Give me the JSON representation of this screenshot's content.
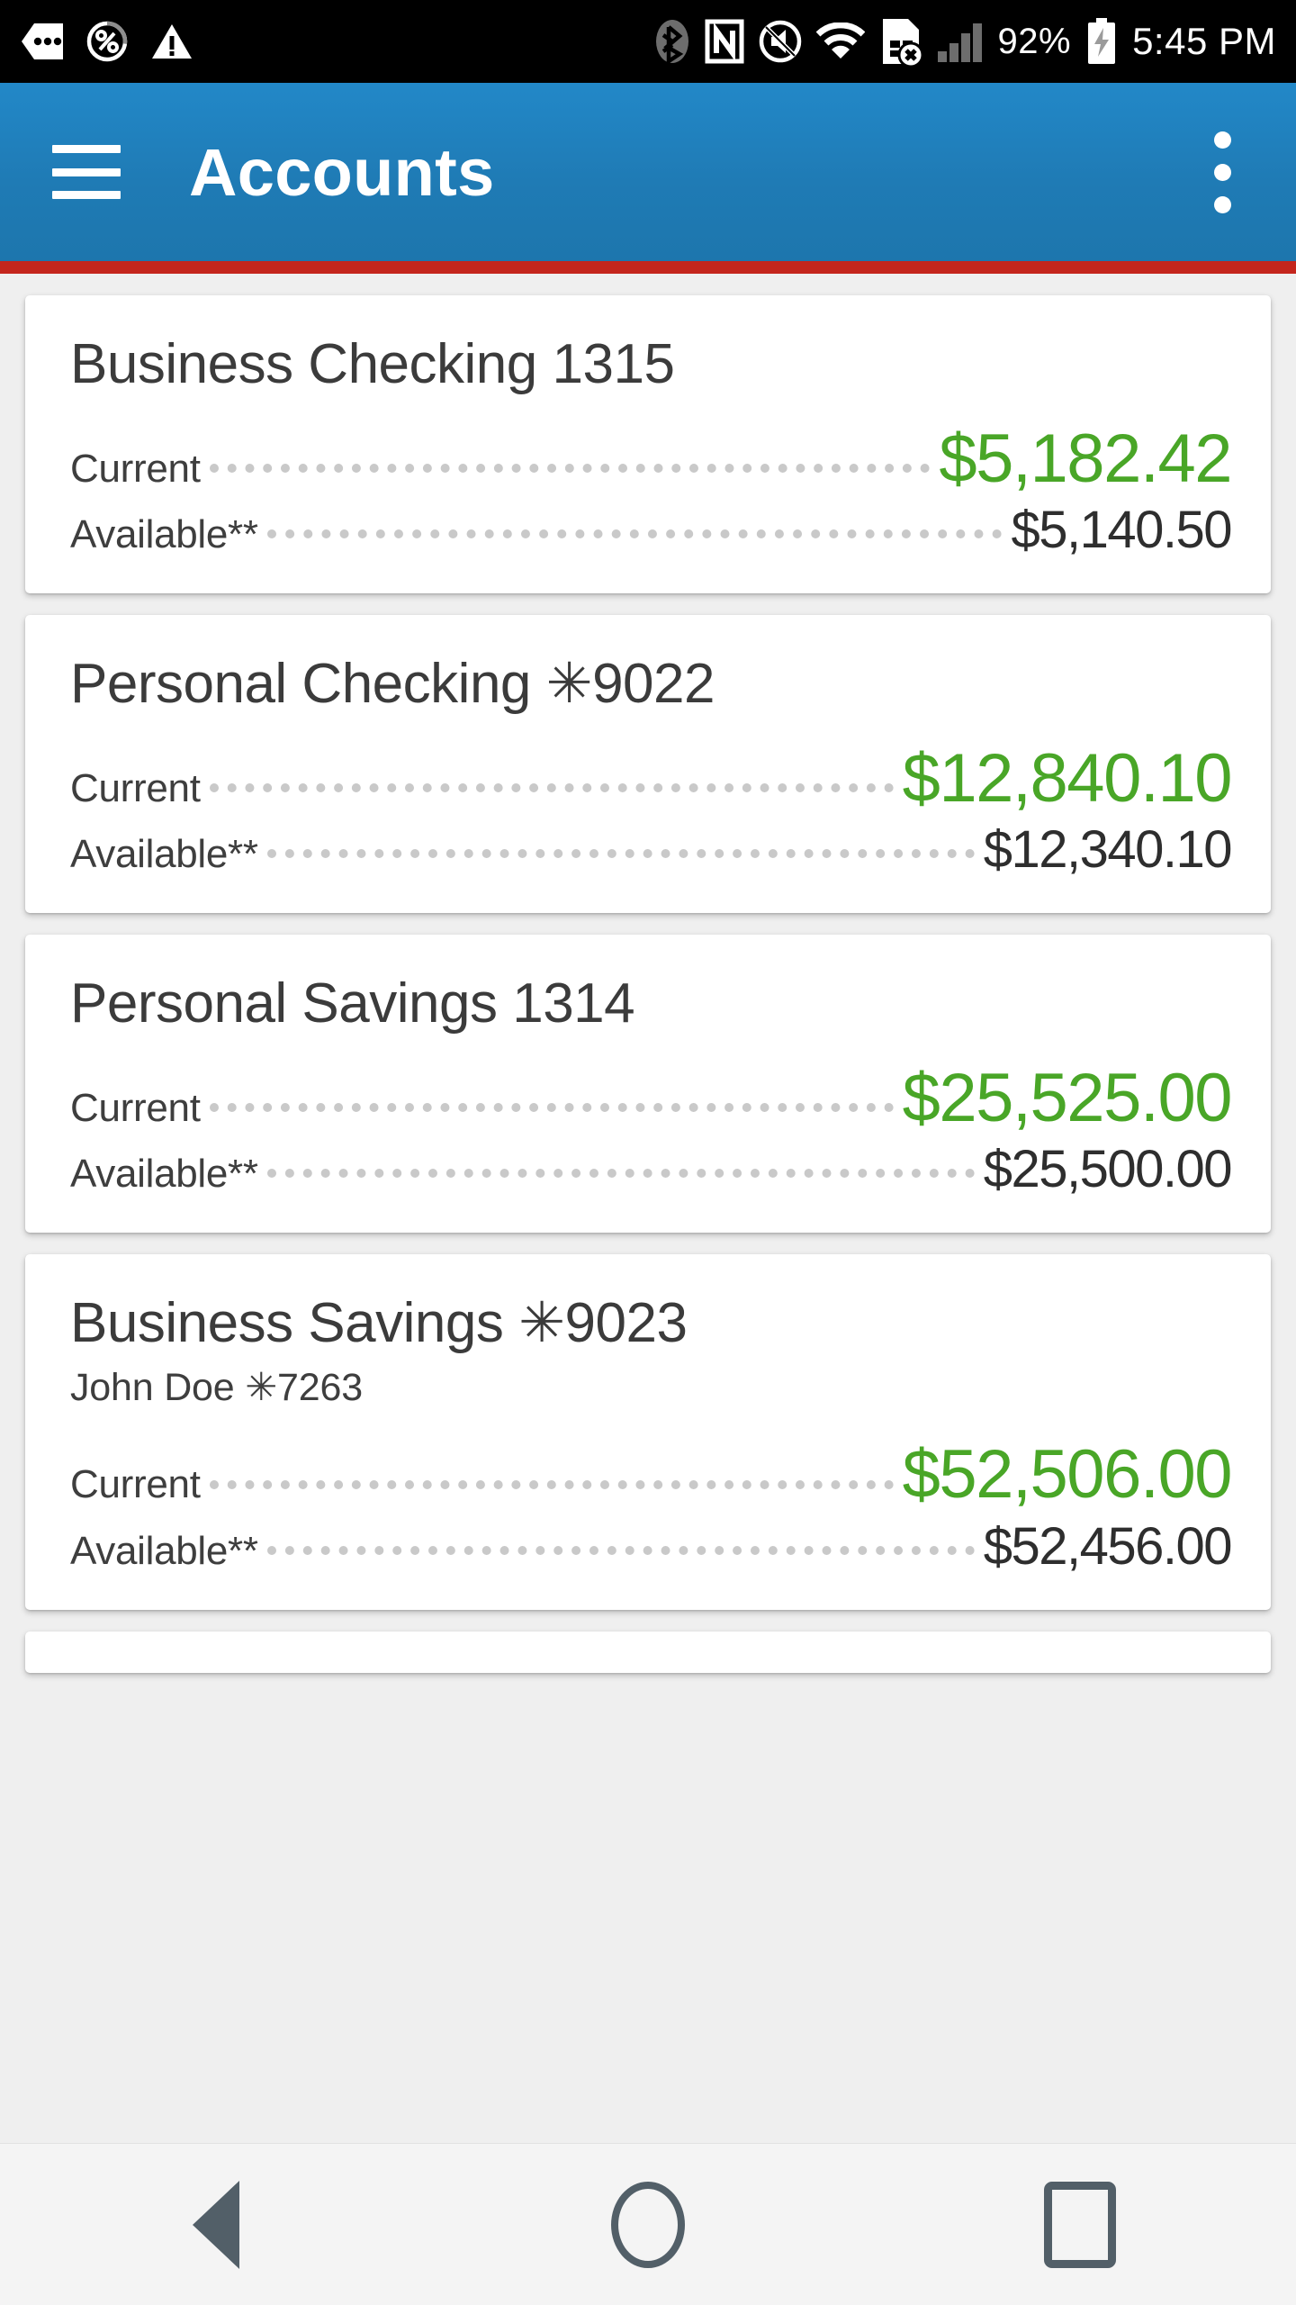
{
  "status_bar": {
    "left_icons": [
      "chat-bubble-icon",
      "percent-circle-icon",
      "warning-triangle-icon"
    ],
    "right_icons": [
      "bluetooth-icon",
      "nfc-icon",
      "mute-icon",
      "wifi-icon",
      "sim-error-icon",
      "signal-bars-icon"
    ],
    "battery_percent": "92%",
    "battery_icon": "battery-charging-icon",
    "clock": "5:45 PM"
  },
  "app_bar": {
    "menu_icon": "hamburger-menu-icon",
    "title": "Accounts",
    "overflow_icon": "overflow-menu-icon",
    "background_color": "#1f7bb5",
    "accent_color": "#c4261d"
  },
  "colors": {
    "current_balance": "#49a627",
    "available_balance": "#2e2e2e",
    "page_background": "#efefef",
    "card_background": "#ffffff"
  },
  "labels": {
    "current": "Current",
    "available": "Available**"
  },
  "accounts": [
    {
      "title": "Business Checking 1315",
      "subtitle": "",
      "current_label": "Current",
      "current_value": "$5,182.42",
      "available_label": "Available**",
      "available_value": "$5,140.50"
    },
    {
      "title": "Personal Checking ✳9022",
      "subtitle": "",
      "current_label": "Current",
      "current_value": "$12,840.10",
      "available_label": "Available**",
      "available_value": "$12,340.10"
    },
    {
      "title": "Personal Savings 1314",
      "subtitle": "",
      "current_label": "Current",
      "current_value": "$25,525.00",
      "available_label": "Available**",
      "available_value": "$25,500.00"
    },
    {
      "title": "Business Savings ✳9023",
      "subtitle": "John Doe ✳7263",
      "current_label": "Current",
      "current_value": "$52,506.00",
      "available_label": "Available**",
      "available_value": "$52,456.00"
    }
  ],
  "nav_bar": {
    "back_label": "back-button",
    "home_label": "home-button",
    "recents_label": "recents-button"
  }
}
